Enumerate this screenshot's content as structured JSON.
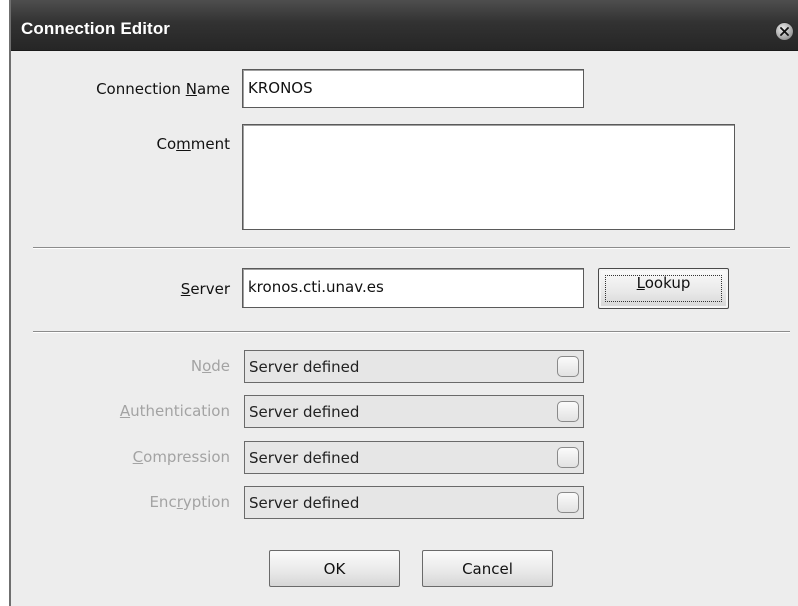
{
  "window": {
    "title": "Connection Editor"
  },
  "form": {
    "connection_name": {
      "label_pre": "Connection ",
      "label_key": "N",
      "label_post": "ame",
      "value": "KRONOS"
    },
    "comment": {
      "label_pre": "Co",
      "label_key": "m",
      "label_post": "ment",
      "value": ""
    },
    "server": {
      "label_pre": "",
      "label_key": "S",
      "label_post": "erver",
      "value": "kronos.cti.unav.es"
    },
    "lookup_button": {
      "label_pre": "",
      "label_key": "L",
      "label_post": "ookup"
    },
    "node": {
      "label_pre": "N",
      "label_key": "o",
      "label_post": "de",
      "value": "Server defined"
    },
    "authentication": {
      "label_pre": "",
      "label_key": "A",
      "label_post": "uthentication",
      "value": "Server defined"
    },
    "compression": {
      "label_pre": "",
      "label_key": "C",
      "label_post": "ompression",
      "value": "Server defined"
    },
    "encryption": {
      "label_pre": "Enc",
      "label_key": "r",
      "label_post": "yption",
      "value": "Server defined"
    }
  },
  "buttons": {
    "ok": "OK",
    "cancel": "Cancel"
  }
}
